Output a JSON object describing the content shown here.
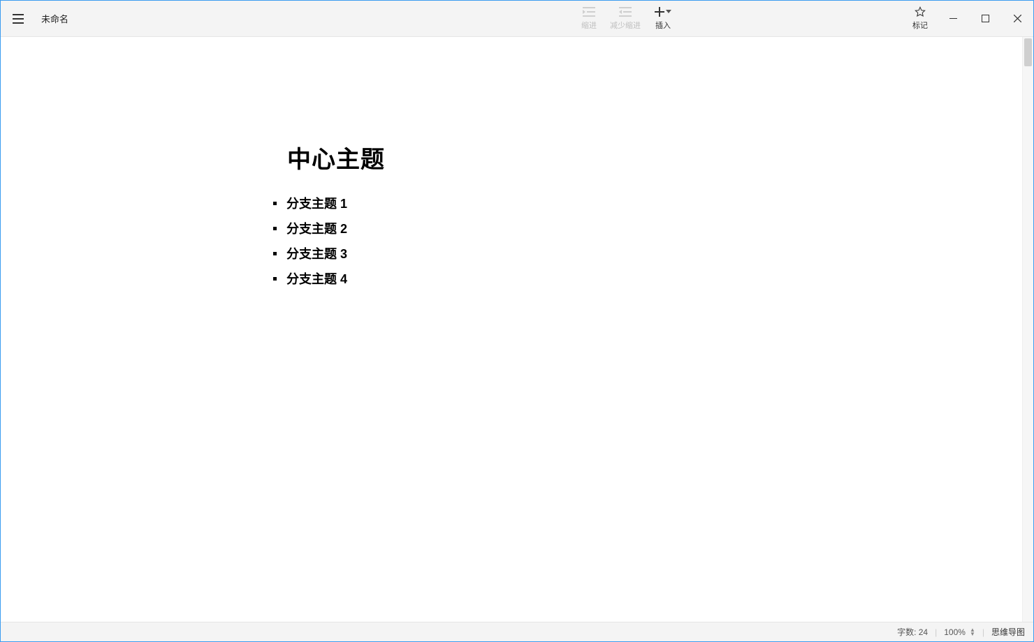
{
  "header": {
    "doc_title": "未命名",
    "tools": {
      "indent_label": "缩进",
      "outdent_label": "减少缩进",
      "insert_label": "插入",
      "mark_label": "标记"
    }
  },
  "outline": {
    "main_title": "中心主题",
    "branches": [
      "分支主题 1",
      "分支主题 2",
      "分支主题 3",
      "分支主题 4"
    ]
  },
  "statusbar": {
    "word_count_label": "字数:",
    "word_count_value": "24",
    "zoom": "100%",
    "mindmap_label": "思维导图"
  }
}
